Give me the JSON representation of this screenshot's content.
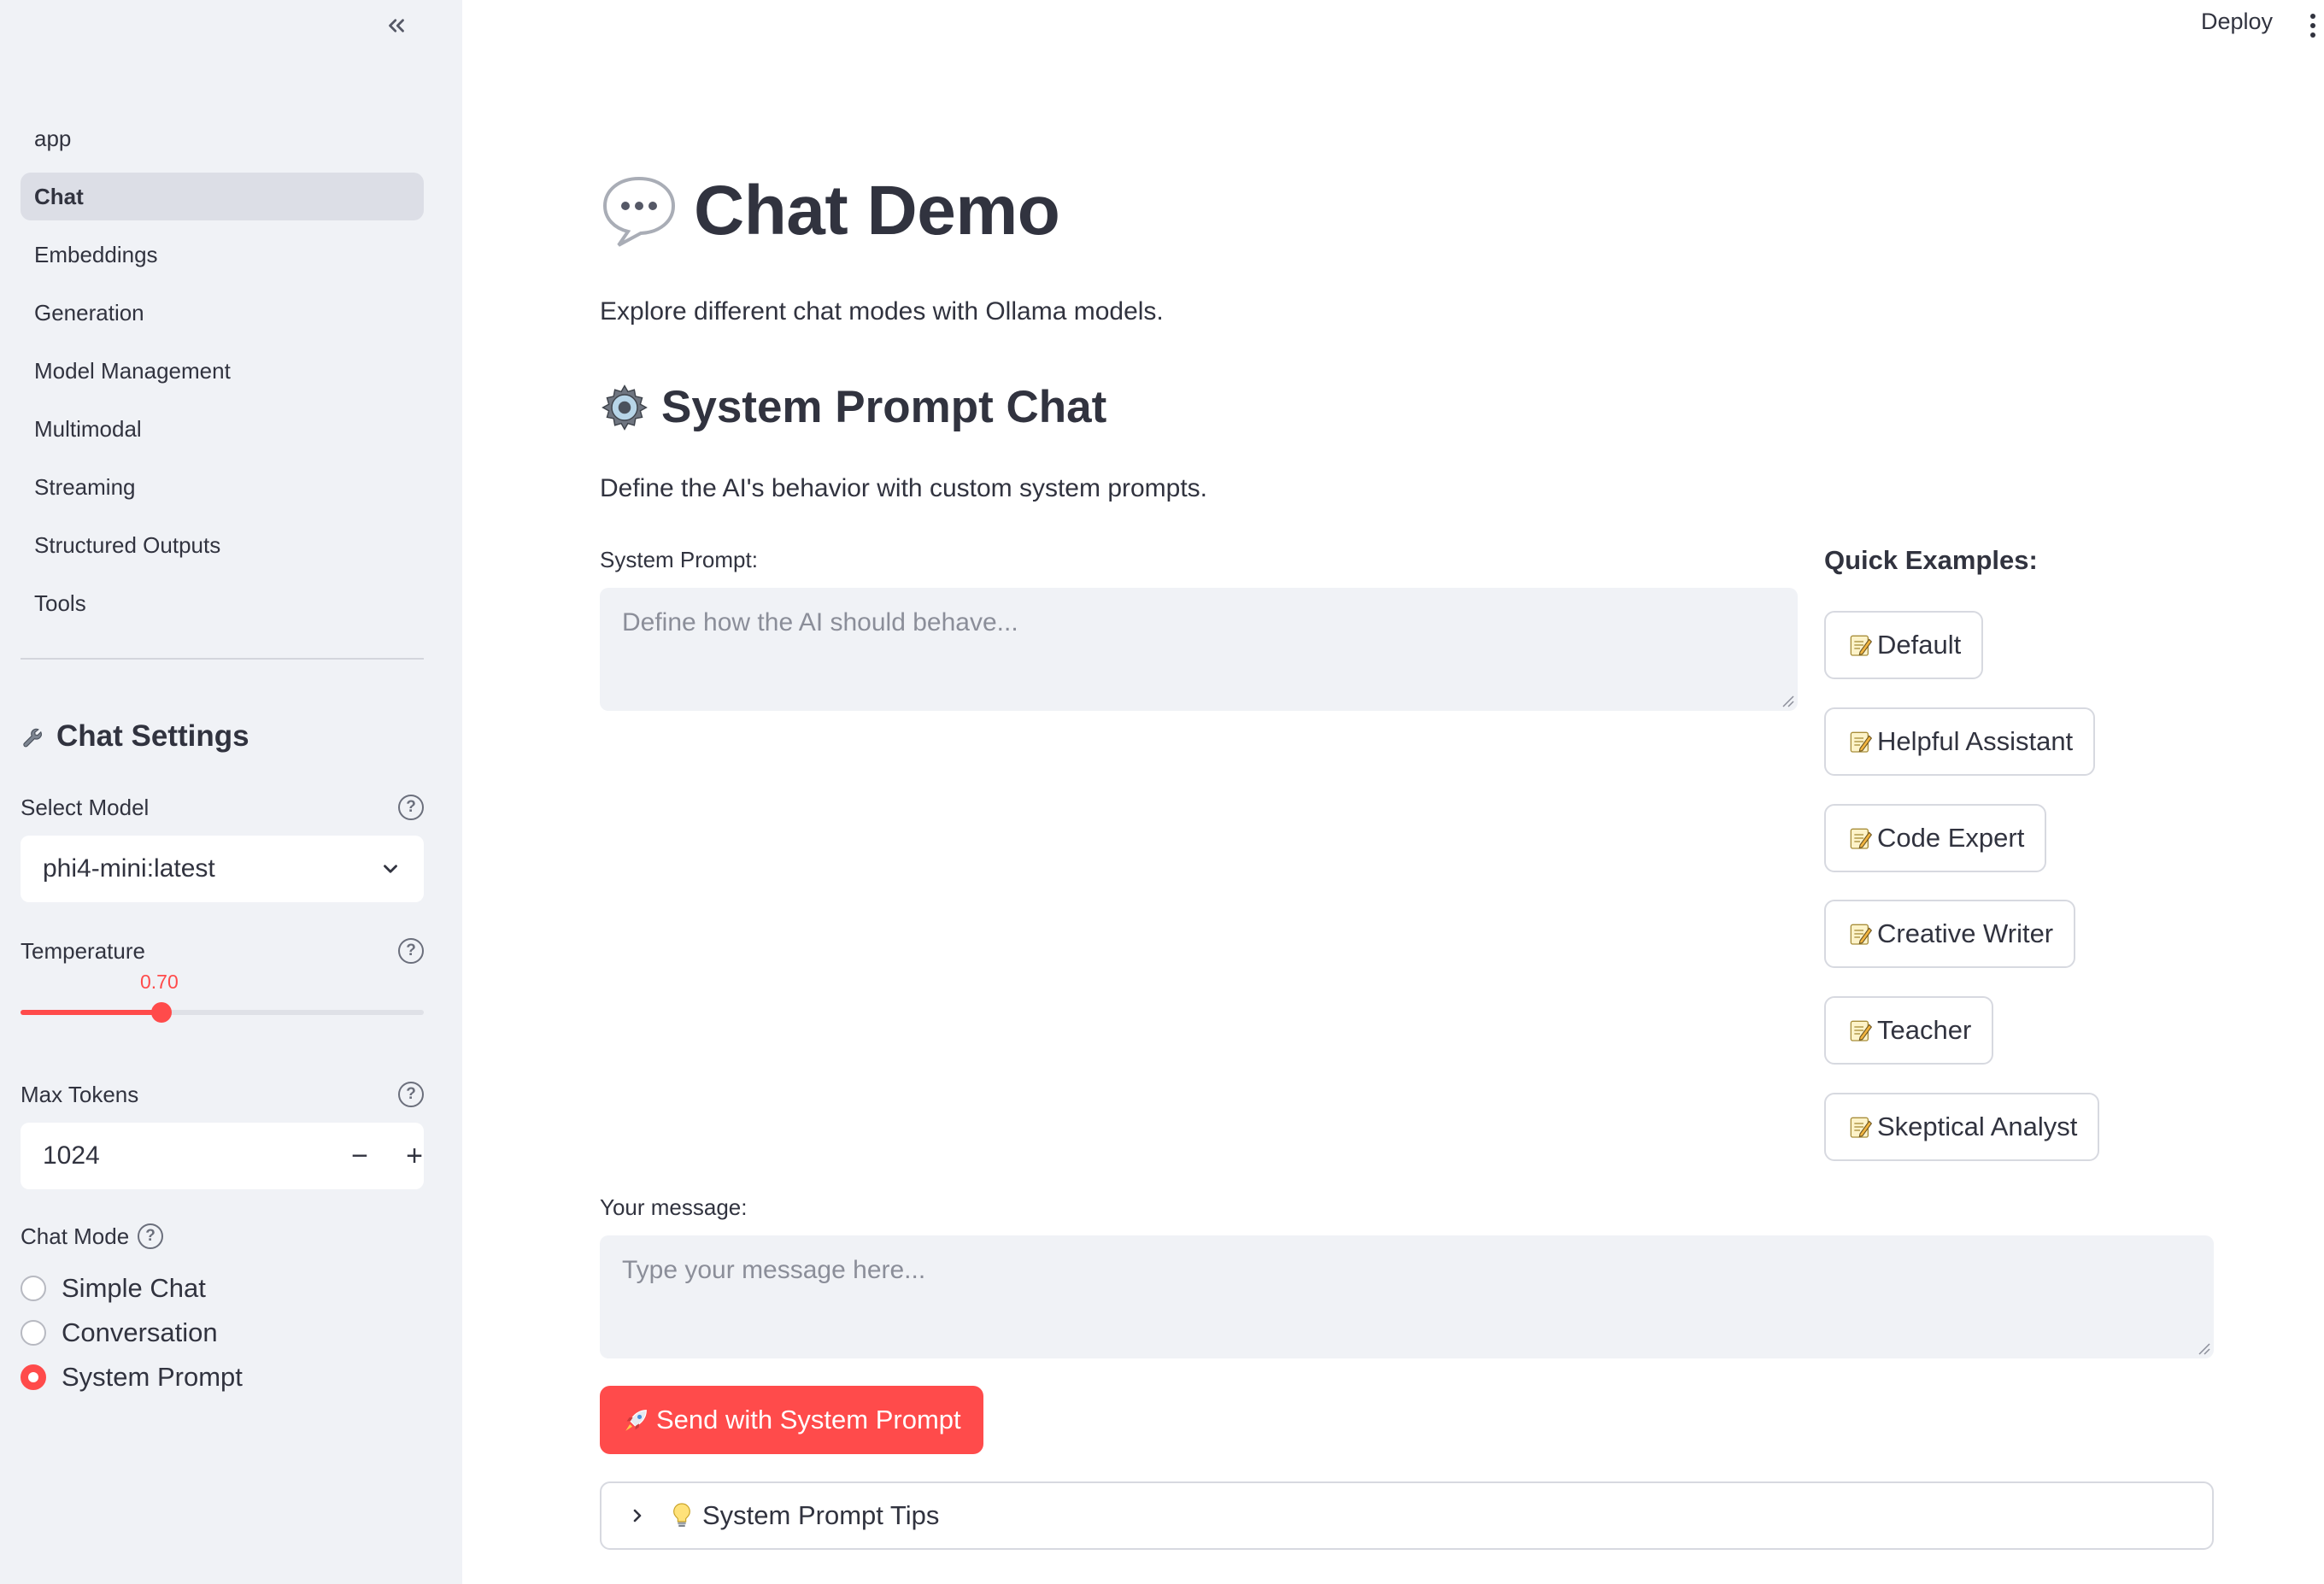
{
  "header": {
    "deploy_label": "Deploy",
    "menu_icon": "more-vertical-icon"
  },
  "sidebar": {
    "collapse_icon": "double-chevron-left-icon",
    "nav": [
      {
        "label": "app",
        "active": false
      },
      {
        "label": "Chat",
        "active": true
      },
      {
        "label": "Embeddings",
        "active": false
      },
      {
        "label": "Generation",
        "active": false
      },
      {
        "label": "Model Management",
        "active": false
      },
      {
        "label": "Multimodal",
        "active": false
      },
      {
        "label": "Streaming",
        "active": false
      },
      {
        "label": "Structured Outputs",
        "active": false
      },
      {
        "label": "Tools",
        "active": false
      }
    ],
    "settings_title": "Chat Settings",
    "settings_icon": "wrench-icon",
    "model": {
      "label": "Select Model",
      "value": "phi4-mini:latest"
    },
    "temperature": {
      "label": "Temperature",
      "value_text": "0.70",
      "value": 0.7,
      "min": 0,
      "max": 2
    },
    "max_tokens": {
      "label": "Max Tokens",
      "value": "1024",
      "decrement": "−",
      "increment": "+"
    },
    "chat_mode": {
      "label": "Chat Mode",
      "options": [
        {
          "label": "Simple Chat",
          "selected": false
        },
        {
          "label": "Conversation",
          "selected": false
        },
        {
          "label": "System Prompt",
          "selected": true
        }
      ]
    }
  },
  "main": {
    "title": "Chat Demo",
    "title_icon": "speech-bubble-icon",
    "subtitle": "Explore different chat modes with Ollama models.",
    "section_title": "System Prompt Chat",
    "section_icon": "gear-icon",
    "section_desc": "Define the AI's behavior with custom system prompts.",
    "system_prompt": {
      "label": "System Prompt:",
      "placeholder": "Define how the AI should behave..."
    },
    "quick_examples": {
      "title": "Quick Examples:",
      "items": [
        "Default",
        "Helpful Assistant",
        "Code Expert",
        "Creative Writer",
        "Teacher",
        "Skeptical Analyst"
      ],
      "item_icon": "memo-icon"
    },
    "message": {
      "label": "Your message:",
      "placeholder": "Type your message here..."
    },
    "send_button": "Send with System Prompt",
    "send_icon": "rocket-icon",
    "tips": {
      "label": "System Prompt Tips",
      "icon": "lightbulb-icon"
    }
  },
  "colors": {
    "accent": "#ff4b4b",
    "sidebar_bg": "#f0f2f6",
    "text": "#31333f"
  }
}
